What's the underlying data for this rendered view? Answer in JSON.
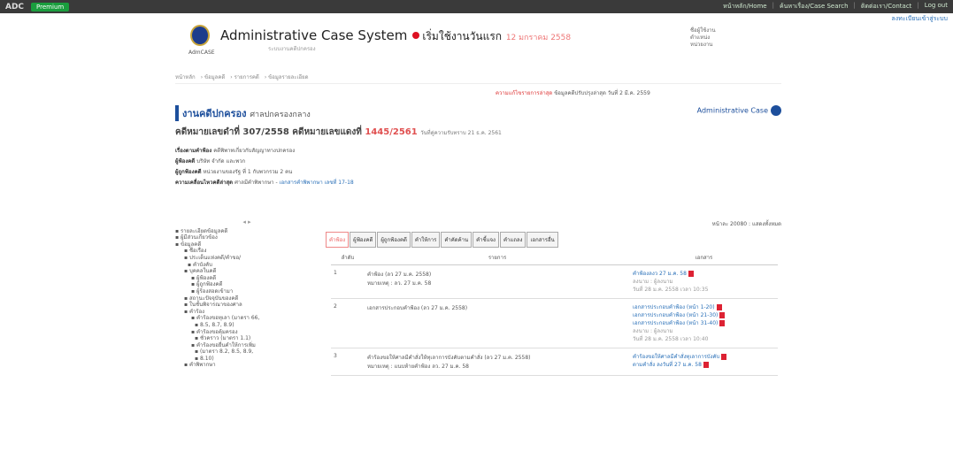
{
  "topbar": {
    "logo": "ADC",
    "tag": "Premium",
    "links": [
      "หน้าหลัก/Home",
      "ค้นหาเรื่อง/Case Search",
      "ติดต่อเรา/Contact",
      "Log out"
    ]
  },
  "sublink": "ลงทะเบียนเข้าสู่ระบบ",
  "header": {
    "title": "Administrative Case System",
    "status": "เริ่มใช้งานวันแรก",
    "date": "12 มกราคม 2558",
    "logo_text": "AdmCASE",
    "sub": "ระบบงานคดีปกครอง",
    "user": [
      "ชื่อผู้ใช้งาน",
      "ตำแหน่ง",
      "หน่วยงาน"
    ]
  },
  "breadcrumb": [
    "หน้าหลัก",
    "ข้อมูลคดี",
    "รายการคดี",
    "ข้อมูลรายละเอียด"
  ],
  "notice": {
    "highlight": "ความแก้ไขรายการล่าสุด",
    "text": "ข้อมูลคดีปรับปรุงล่าสุด วันที่ 2 มี.ค. 2559"
  },
  "case": {
    "court": "งานคดีปกครอง",
    "court_sub": "ศาลปกครองกลาง",
    "brand": "Administrative Case",
    "black_no_label": "คดีหมายเลขดำที่",
    "black_no": "307/2558",
    "red_no_label": "คดีหมายเลขแดงที่",
    "red_no": "1445/2561",
    "red_date": "วันที่คู่ความรับทราบ 21 ธ.ค. 2561",
    "fields": [
      {
        "label": "เรื่องตามคำฟ้อง",
        "value": "คดีพิพาทเกี่ยวกับสัญญาทางปกครอง"
      },
      {
        "label": "ผู้ฟ้องคดี",
        "value": "บริษัท จำกัด และพวก"
      },
      {
        "label": "ผู้ถูกฟ้องคดี",
        "value": "หน่วยงานของรัฐ ที่ 1 กับพวกรวม 2 คน"
      },
      {
        "label": "ความเคลื่อนไหวคดีล่าสุด",
        "value": "ศาลมีคำพิพากษา",
        "link": "เอกสารคำพิพากษา เลขที่ 17-18"
      }
    ]
  },
  "tree": {
    "toggle": "◂ ▸",
    "items": [
      {
        "t": "รายละเอียดข้อมูลคดี",
        "i": 0
      },
      {
        "t": "ผู้มีส่วนเกี่ยวข้อง",
        "i": 0
      },
      {
        "t": "ข้อมูลคดี",
        "i": 0
      },
      {
        "t": "ชื่อเรื่อง",
        "i": 10
      },
      {
        "t": "ประเด็นแห่งคดี/คำขอ/",
        "i": 10
      },
      {
        "t": "คำบังคับ",
        "i": 14
      },
      {
        "t": "บุคคลในคดี",
        "i": 10
      },
      {
        "t": "ผู้ฟ้องคดี",
        "i": 18
      },
      {
        "t": "ผู้ถูกฟ้องคดี",
        "i": 18
      },
      {
        "t": "ผู้ร้องสอดเข้ามา",
        "i": 18
      },
      {
        "t": "สถานะปัจจุบันของคดี",
        "i": 10
      },
      {
        "t": "ในชั้นพิจารณาของศาล",
        "i": 10
      },
      {
        "t": "คำร้อง",
        "i": 10
      },
      {
        "t": "คำร้องขอทุเลา (มาตรา 66,",
        "i": 18
      },
      {
        "t": "8.5, 8.7, 8.9)",
        "i": 22
      },
      {
        "t": "คำร้องขอคุ้มครอง",
        "i": 18
      },
      {
        "t": "ชั่วคราว (มาตรา 1.1)",
        "i": 22
      },
      {
        "t": "คำร้องขอยื่นคำให้การเพิ่ม",
        "i": 18
      },
      {
        "t": "(มาตรา 8.2, 8.5, 8.9,",
        "i": 22
      },
      {
        "t": "8.10)",
        "i": 22
      },
      {
        "t": "คำพิพากษา",
        "i": 10
      }
    ]
  },
  "panel": {
    "count": "หน้าละ 20080 : แสดงทั้งหมด",
    "tabs": [
      "คำฟ้อง",
      "ผู้ฟ้องคดี",
      "ผู้ถูกฟ้องคดี",
      "คำให้การ",
      "คำคัดค้าน",
      "คำชี้แจง",
      "คำแถลง",
      "เอกสารอื่น"
    ],
    "headers": [
      "ลำดับ",
      "รายการ",
      "เอกสาร"
    ],
    "rows": [
      {
        "no": "1",
        "items": [
          "คำฟ้อง (ลว 27 ม.ค. 2558)",
          "หมายเหตุ : ลว. 27 ม.ค. 58"
        ],
        "docs": [
          "คำฟ้องลงว 27 ม.ค. 58",
          "ลงนาม : ผู้ลงนาม",
          "วันที่ 28 ม.ค. 2558 เวลา 10:35"
        ]
      },
      {
        "no": "2",
        "items": [
          "เอกสารประกอบคำฟ้อง (ลว 27 ม.ค. 2558)"
        ],
        "docs": [
          "เอกสารประกอบคำฟ้อง (หน้า 1-20)",
          "เอกสารประกอบคำฟ้อง (หน้า 21-30)",
          "เอกสารประกอบคำฟ้อง (หน้า 31-40)",
          "ลงนาม : ผู้ลงนาม",
          "วันที่ 28 ม.ค. 2558 เวลา 10:40"
        ]
      },
      {
        "no": "3",
        "items": [
          "คำร้องขอให้ศาลมีคำสั่งให้ทุเลาการบังคับตามคำสั่ง (ลว 27 ม.ค. 2558)",
          "หมายเหตุ : แนบท้ายคำฟ้อง ลว. 27 ม.ค. 58"
        ],
        "docs": [
          "คำร้องขอให้ศาลมีคำสั่งทุเลาการบังคับ",
          "ตามคำสั่ง ลงวันที่ 27 ม.ค. 58"
        ]
      }
    ]
  }
}
